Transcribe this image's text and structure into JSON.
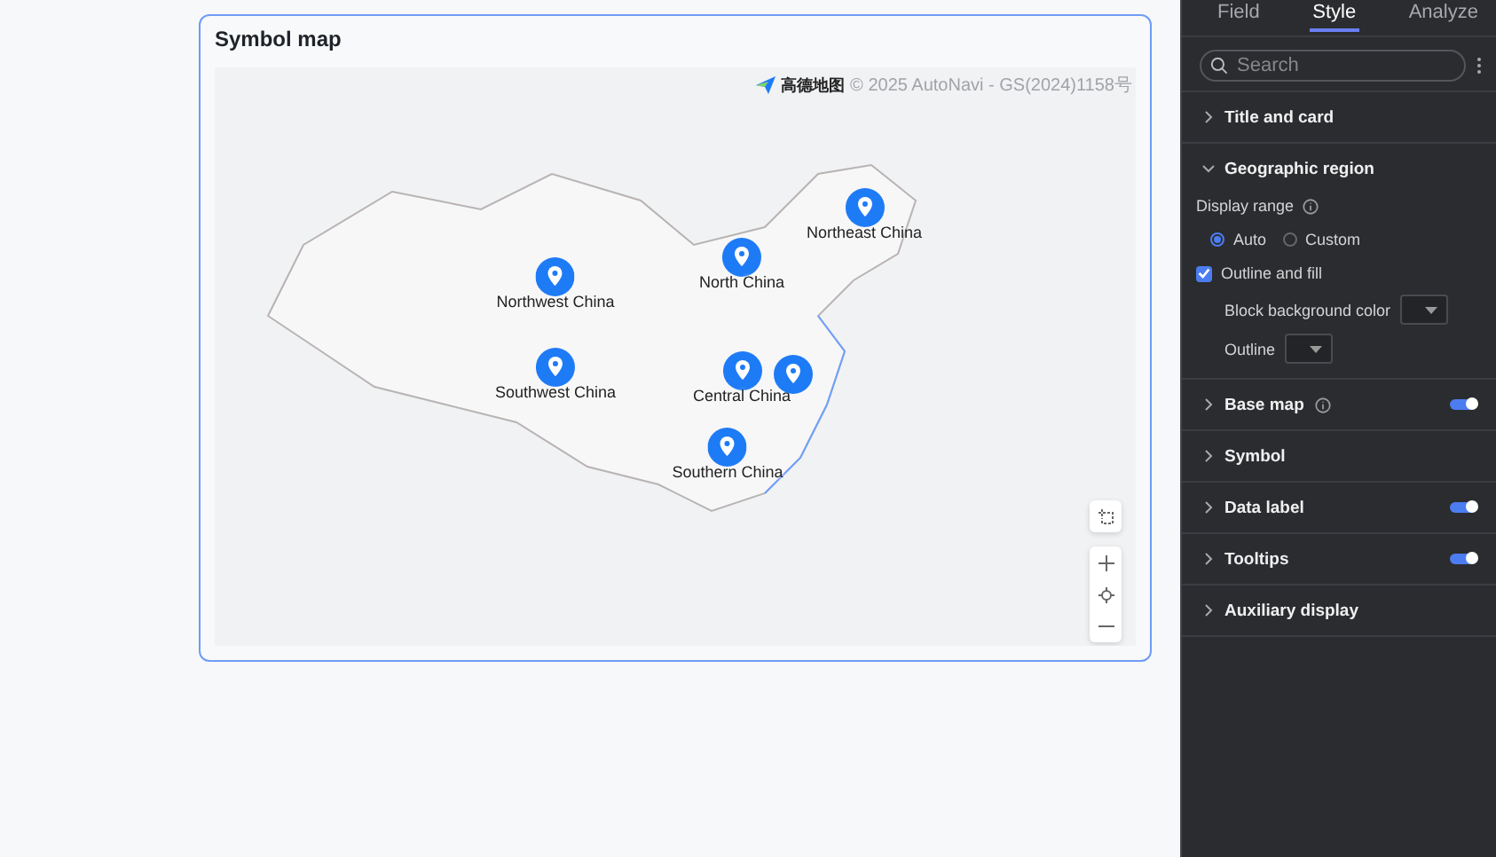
{
  "card": {
    "title": "Symbol map",
    "attribution": {
      "logo_text": "高德地图",
      "text": "© 2025 AutoNavi - GS(2024)1158号"
    },
    "markers": [
      {
        "kind": "labeled",
        "label": "Northeast China"
      },
      {
        "kind": "labeled",
        "label": "North China"
      },
      {
        "kind": "labeled",
        "label": "Northwest China"
      },
      {
        "kind": "labeled",
        "label": "Southwest China"
      },
      {
        "kind": "labeled",
        "label": "Central China"
      },
      {
        "kind": "pin"
      },
      {
        "kind": "labeled",
        "label": "Southern China"
      }
    ]
  },
  "panel": {
    "tabs": [
      {
        "label": "Field",
        "selected": false
      },
      {
        "label": "Style",
        "selected": true
      },
      {
        "label": "Analyze",
        "selected": false
      }
    ],
    "search": {
      "placeholder": "Search"
    },
    "sections": [
      {
        "title": "Title and card",
        "expanded": false
      },
      {
        "title": "Geographic region",
        "expanded": true,
        "display_range": {
          "label": "Display range",
          "options": [
            {
              "label": "Auto",
              "selected": true
            },
            {
              "label": "Custom",
              "selected": false
            }
          ]
        },
        "outline_fill": {
          "label": "Outline and fill",
          "checked": true
        },
        "colors": [
          {
            "label": "Block background color"
          },
          {
            "label": "Outline"
          }
        ]
      },
      {
        "title": "Base map",
        "expanded": false,
        "info": true,
        "toggle": {
          "on": true
        }
      },
      {
        "title": "Symbol",
        "expanded": false
      },
      {
        "title": "Data label",
        "expanded": false,
        "toggle": {
          "on": true
        }
      },
      {
        "title": "Tooltips",
        "expanded": false,
        "toggle": {
          "on": true
        }
      },
      {
        "title": "Auxiliary display",
        "expanded": false
      }
    ]
  }
}
